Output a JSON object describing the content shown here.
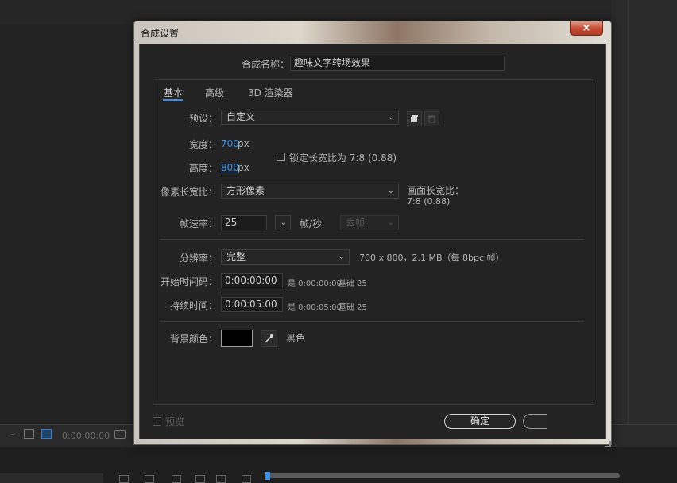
{
  "dialog": {
    "title": "合成设置",
    "close_glyph": "×"
  },
  "composition_name": {
    "label": "合成名称：",
    "value": "趣味文字转场效果"
  },
  "tabs": [
    {
      "label": "基本",
      "active": true
    },
    {
      "label": "高级",
      "active": false
    },
    {
      "label": "3D 渲染器",
      "active": false
    }
  ],
  "preset": {
    "label": "预设：",
    "value": "自定义"
  },
  "width": {
    "label": "宽度：",
    "value": "700",
    "unit": "px"
  },
  "height": {
    "label": "高度：",
    "value": "800",
    "unit": "px"
  },
  "lock_aspect": {
    "label": "锁定长宽比为 7:8 (0.88)",
    "checked": false
  },
  "pixel_aspect": {
    "label": "像素长宽比：",
    "value": "方形像素"
  },
  "frame_aspect": {
    "label": "画面长宽比：",
    "value": "7:8 (0.88)"
  },
  "frame_rate": {
    "label": "帧速率：",
    "value": "25",
    "unit": "帧/秒",
    "mode": "丢帧"
  },
  "resolution": {
    "label": "分辨率：",
    "value": "完整",
    "info": "700 x 800，2.1 MB（每 8bpc 帧）"
  },
  "start_timecode": {
    "label": "开始时间码：",
    "value": "0:00:00:00",
    "info1": "是 0:00:00:00",
    "info2": "基础 25"
  },
  "duration": {
    "label": "持续时间：",
    "value": "0:00:05:00",
    "info1": "是 0:00:05:00",
    "info2": "基础 25"
  },
  "background_color": {
    "label": "背景颜色：",
    "swatch": "#000000",
    "name": "黑色"
  },
  "footer": {
    "preview_label": "预览",
    "ok_label": "确定"
  },
  "background_app": {
    "timecode": "0:00:00:00"
  },
  "colors": {
    "accent": "#3a8ee6",
    "close": "#c54a33"
  }
}
